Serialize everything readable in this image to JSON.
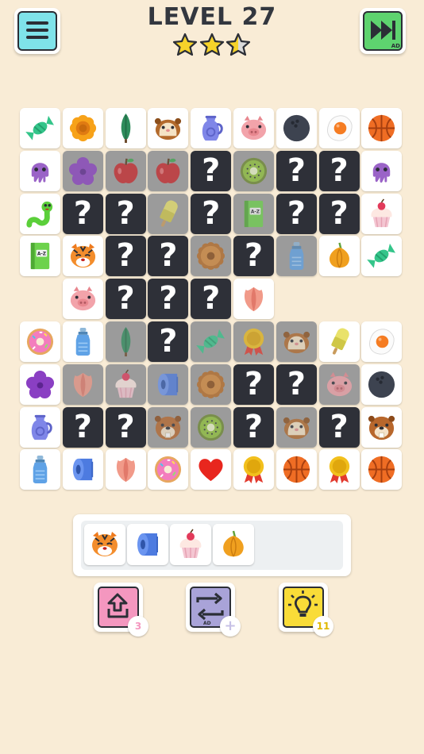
{
  "header": {
    "title": "LEVEL 27",
    "stars": 2.5,
    "ad_label": "AD"
  },
  "board": {
    "tiles": [
      {
        "icon": "candy-icon",
        "state": "open"
      },
      {
        "icon": "flower-orange-icon",
        "state": "open"
      },
      {
        "icon": "cypress-icon",
        "state": "open"
      },
      {
        "icon": "hamster-icon",
        "state": "open"
      },
      {
        "icon": "jug-icon",
        "state": "open"
      },
      {
        "icon": "pig-icon",
        "state": "open"
      },
      {
        "icon": "bowling-ball-icon",
        "state": "open"
      },
      {
        "icon": "egg-icon",
        "state": "open"
      },
      {
        "icon": "basketball-icon",
        "state": "open"
      },
      {
        "icon": "octopus-icon",
        "state": "open"
      },
      {
        "icon": "violet-icon",
        "state": "dim"
      },
      {
        "icon": "apple-icon",
        "state": "dim"
      },
      {
        "icon": "apple-icon",
        "state": "dim"
      },
      {
        "icon": "hidden",
        "state": "hidden"
      },
      {
        "icon": "kiwi-icon",
        "state": "dim"
      },
      {
        "icon": "hidden",
        "state": "hidden"
      },
      {
        "icon": "hidden",
        "state": "hidden"
      },
      {
        "icon": "octopus-icon",
        "state": "open"
      },
      {
        "icon": "worm-icon",
        "state": "open"
      },
      {
        "icon": "hidden",
        "state": "hidden"
      },
      {
        "icon": "hidden",
        "state": "hidden"
      },
      {
        "icon": "popsicle-icon",
        "state": "dim"
      },
      {
        "icon": "hidden",
        "state": "hidden"
      },
      {
        "icon": "book-icon",
        "state": "dim"
      },
      {
        "icon": "hidden",
        "state": "hidden"
      },
      {
        "icon": "hidden",
        "state": "hidden"
      },
      {
        "icon": "cupcake-icon",
        "state": "open"
      },
      {
        "icon": "book-icon",
        "state": "open"
      },
      {
        "icon": "tiger-icon",
        "state": "open"
      },
      {
        "icon": "hidden",
        "state": "hidden"
      },
      {
        "icon": "hidden",
        "state": "hidden"
      },
      {
        "icon": "donut-brown-icon",
        "state": "dim"
      },
      {
        "icon": "hidden",
        "state": "hidden"
      },
      {
        "icon": "bottle-icon",
        "state": "dim"
      },
      {
        "icon": "onion-icon",
        "state": "open"
      },
      {
        "icon": "candy-icon",
        "state": "open"
      },
      {
        "icon": "empty",
        "state": "empty"
      },
      {
        "icon": "pig-icon",
        "state": "open"
      },
      {
        "icon": "hidden",
        "state": "hidden"
      },
      {
        "icon": "hidden",
        "state": "hidden"
      },
      {
        "icon": "hidden",
        "state": "hidden"
      },
      {
        "icon": "tulip-icon",
        "state": "open"
      },
      {
        "icon": "empty",
        "state": "empty"
      },
      {
        "icon": "empty",
        "state": "empty"
      },
      {
        "icon": "empty",
        "state": "empty"
      },
      {
        "icon": "donut-pink-icon",
        "state": "open"
      },
      {
        "icon": "bottle-icon",
        "state": "open"
      },
      {
        "icon": "cypress-icon",
        "state": "dim"
      },
      {
        "icon": "hidden",
        "state": "hidden"
      },
      {
        "icon": "candy-icon",
        "state": "dim"
      },
      {
        "icon": "medal-icon",
        "state": "dim"
      },
      {
        "icon": "hamster-icon",
        "state": "dim"
      },
      {
        "icon": "popsicle-icon",
        "state": "open"
      },
      {
        "icon": "egg-icon",
        "state": "open"
      },
      {
        "icon": "violet-icon",
        "state": "open"
      },
      {
        "icon": "tulip-icon",
        "state": "dim"
      },
      {
        "icon": "cupcake-icon",
        "state": "dim"
      },
      {
        "icon": "toilet-paper-icon",
        "state": "dim"
      },
      {
        "icon": "donut-brown-icon",
        "state": "dim"
      },
      {
        "icon": "hidden",
        "state": "hidden"
      },
      {
        "icon": "hidden",
        "state": "hidden"
      },
      {
        "icon": "pig-icon",
        "state": "dim"
      },
      {
        "icon": "bowling-ball-icon",
        "state": "open"
      },
      {
        "icon": "jug-icon",
        "state": "open"
      },
      {
        "icon": "hidden",
        "state": "hidden"
      },
      {
        "icon": "hidden",
        "state": "hidden"
      },
      {
        "icon": "beaver-icon",
        "state": "dim"
      },
      {
        "icon": "kiwi-icon",
        "state": "dim"
      },
      {
        "icon": "hidden",
        "state": "hidden"
      },
      {
        "icon": "hamster-icon",
        "state": "dim"
      },
      {
        "icon": "hidden",
        "state": "hidden"
      },
      {
        "icon": "beaver-icon",
        "state": "open"
      },
      {
        "icon": "bottle-icon",
        "state": "open"
      },
      {
        "icon": "toilet-paper-icon",
        "state": "open"
      },
      {
        "icon": "tulip-icon",
        "state": "open"
      },
      {
        "icon": "donut-pink-icon",
        "state": "open"
      },
      {
        "icon": "heart-icon",
        "state": "open"
      },
      {
        "icon": "medal-icon",
        "state": "open"
      },
      {
        "icon": "basketball-icon",
        "state": "open"
      },
      {
        "icon": "medal-icon",
        "state": "open"
      },
      {
        "icon": "basketball-icon",
        "state": "open"
      }
    ],
    "hidden_mark": "?",
    "book_label": "A-Z"
  },
  "tray": {
    "items": [
      "tiger-icon",
      "toilet-paper-icon",
      "cupcake-icon",
      "onion-icon"
    ]
  },
  "powerups": {
    "undo_count": "3",
    "shuffle_extra": "+",
    "shuffle_ad": "AD",
    "hint_count": "11"
  },
  "colors": {
    "background": "#f9ecd6",
    "menu": "#7fe3ea",
    "skip": "#5ed36f",
    "undo": "#f497bf",
    "shuffle": "#a9a3d8",
    "hint": "#f9dc38",
    "hidden_tile": "#2e3038"
  }
}
